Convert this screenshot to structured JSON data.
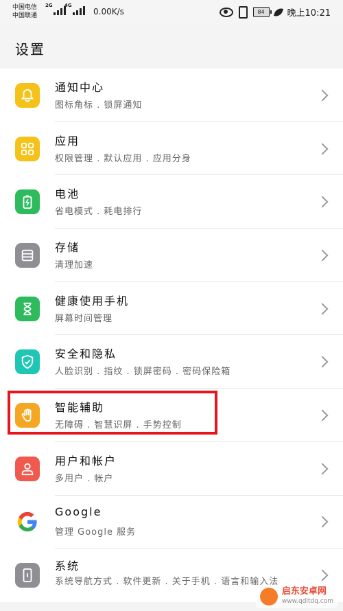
{
  "status_bar": {
    "carrier1": "中国电信",
    "carrier2": "中国联通",
    "net1": "2G",
    "net2": "4G",
    "speed": "0.00K/s",
    "battery": "84",
    "time": "晚上10:21"
  },
  "page": {
    "title": "设置"
  },
  "items": [
    {
      "title": "通知中心",
      "subtitle": "图标角标 . 锁屏通知",
      "icon": "bell-icon",
      "color": "#f5c21a"
    },
    {
      "title": "应用",
      "subtitle": "权限管理 . 默认应用 . 应用分身",
      "icon": "grid-icon",
      "color": "#f5c21a"
    },
    {
      "title": "电池",
      "subtitle": "省电模式 . 耗电排行",
      "icon": "battery-icon",
      "color": "#2dbb5d"
    },
    {
      "title": "存储",
      "subtitle": "清理加速",
      "icon": "storage-icon",
      "color": "#8e8e93"
    },
    {
      "title": "健康使用手机",
      "subtitle": "屏幕时间管理",
      "icon": "hourglass-icon",
      "color": "#2dbb5d"
    },
    {
      "title": "安全和隐私",
      "subtitle": "人脸识别 . 指纹 . 锁屏密码 . 密码保险箱",
      "icon": "shield-icon",
      "color": "#1fc6b4"
    },
    {
      "title": "智能辅助",
      "subtitle": "无障碍 . 智慧识屏 . 手势控制",
      "icon": "hand-icon",
      "color": "#f5a623"
    },
    {
      "title": "用户和帐户",
      "subtitle": "多用户 . 帐户",
      "icon": "user-icon",
      "color": "#f05a4e"
    },
    {
      "title": "Google",
      "subtitle": "管理 Google 服务",
      "icon": "google-icon",
      "color": "#ffffff"
    },
    {
      "title": "系统",
      "subtitle": "系统导航方式 . 软件更新 . 关于手机 . 语言和输入法",
      "icon": "system-icon",
      "color": "#8e8e93"
    }
  ],
  "watermark": {
    "name": "启东安卓网",
    "url": "www.qdltdq.com"
  }
}
